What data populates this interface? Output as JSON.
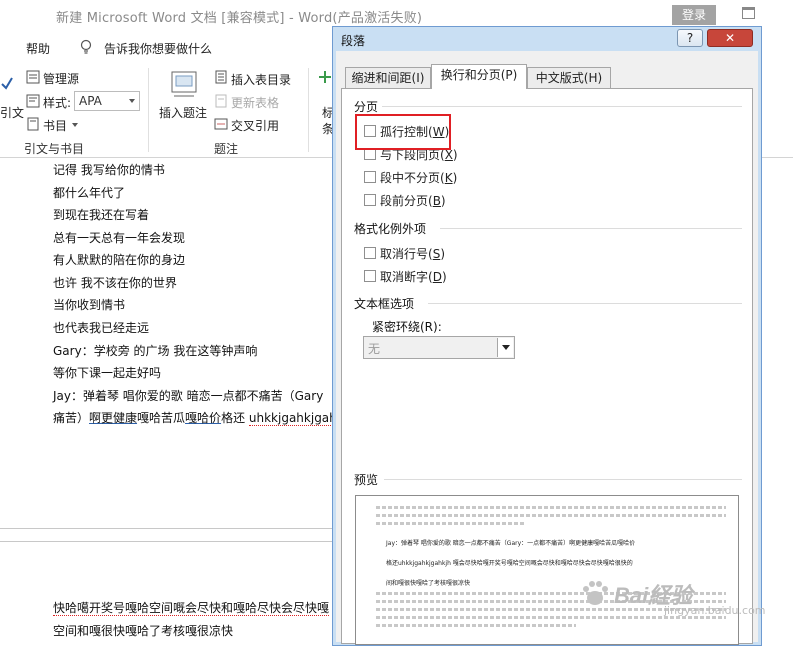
{
  "window": {
    "title": "新建 Microsoft Word 文档 [兼容模式] - Word(产品激活失败)",
    "login_label": "登录"
  },
  "menubar": {
    "help_label": "帮助",
    "tellme_label": "告诉我你想要做什么"
  },
  "ribbon": {
    "citations_group": {
      "citation_partial_label": "引文",
      "manage_sources_label": "管理源",
      "style_label": "样式:",
      "style_value": "APA",
      "bibliography_label": "书目",
      "group_label": "引文与书目"
    },
    "captions_group": {
      "insert_caption_label": "插入题注",
      "insert_table_of_figures_label": "插入表目录",
      "update_table_label": "更新表格",
      "cross_reference_label": "交叉引用",
      "group_label": "题注"
    },
    "partial_labels": [
      "标",
      "条"
    ]
  },
  "document": {
    "lines": [
      "记得  我写给你的情书",
      "都什么年代了",
      "到现在我还在写着",
      "总有一天总有一年会发现",
      "有人默默的陪在你的身边",
      "也许  我不该在你的世界",
      "当你收到情书",
      "也代表我已经走远",
      "Gary：学校旁  的广场  我在这等钟声响",
      "等你下课一起走好吗",
      "Jay：弹着琴  唱你爱的歌  暗恋一点都不痛苦（Gary"
    ],
    "line12_parts": [
      "痛苦）",
      "啊更健康",
      "嘎哈苦瓜",
      "嘎哈价",
      "格还 ",
      "uhkkjgahkjgah"
    ],
    "bottom_lines": [
      "快哈噶开奖号嘎哈空间嘅会尽快和嘎哈尽快会尽快嘎",
      "空间和嘎很快嘎哈了考核嘎很凉快"
    ]
  },
  "dialog": {
    "title": "段落",
    "help_btn": "?",
    "close_btn": "✕",
    "tabs": [
      {
        "label": "缩进和间距(I)",
        "active": false
      },
      {
        "label": "换行和分页(P)",
        "active": true
      },
      {
        "label": "中文版式(H)",
        "active": false
      }
    ],
    "pagination": {
      "section_label": "分页",
      "options": [
        {
          "label": "孤行控制(",
          "key": "W",
          "checked": false
        },
        {
          "label": "与下段同页(",
          "key": "X",
          "checked": false
        },
        {
          "label": "段中不分页(",
          "key": "K",
          "checked": false
        },
        {
          "label": "段前分页(",
          "key": "B",
          "checked": false
        }
      ]
    },
    "exceptions": {
      "section_label": "格式化例外项",
      "options": [
        {
          "label": "取消行号(",
          "key": "S",
          "checked": false
        },
        {
          "label": "取消断字(",
          "key": "D",
          "checked": false
        }
      ]
    },
    "textbox": {
      "section_label": "文本框选项",
      "tight_wrap_label": "紧密环绕(R):",
      "tight_wrap_value": "无"
    },
    "preview": {
      "section_label": "预览",
      "lines": [
        "Jay：弹着琴 唱你爱的歌 暗恋一点都不痛苦（Gary：一点都不痛苦）啊更健康嘎哈苦瓜嘎哈价",
        "格还uhkkjgahkjgahkjh 嘎会尽快哈嘎开奖号嘎哈空间嘅会尽快和嘎哈尽快会尽快嘎哈很快的",
        "间和嘎很快嘎哈了考核嘎很凉快"
      ]
    }
  },
  "watermark": {
    "text": "Bai経验",
    "sub": "jingyan.baidu.com"
  }
}
